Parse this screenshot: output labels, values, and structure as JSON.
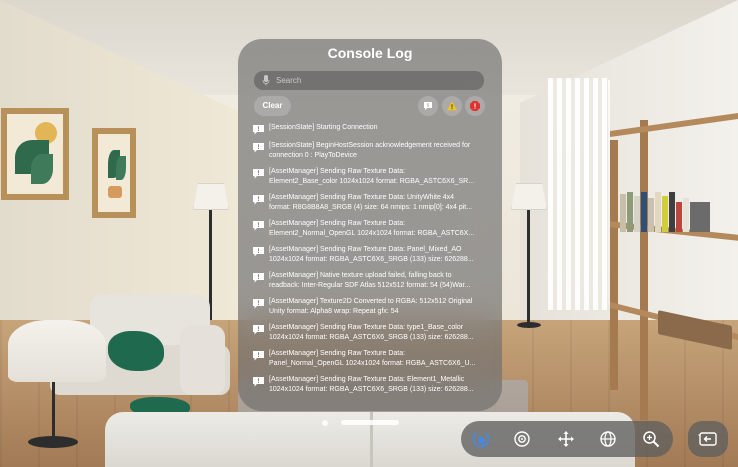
{
  "console": {
    "title": "Console Log",
    "search_placeholder": "Search",
    "clear_label": "Clear",
    "filters": [
      {
        "name": "info",
        "icon": "speech-bubble-icon",
        "color": "#ffffff"
      },
      {
        "name": "warning",
        "icon": "warning-triangle-icon",
        "color": "#f5c518"
      },
      {
        "name": "error",
        "icon": "error-octagon-icon",
        "color": "#e0342f"
      }
    ],
    "entries": [
      {
        "lines": [
          "[SessionState] Starting Connection"
        ]
      },
      {
        "lines": [
          "[SessionState] BeginHostSession acknowledgement received for",
          "connection 0 : PlayToDevice"
        ]
      },
      {
        "lines": [
          "[AssetManager] Sending Raw Texture Data:",
          "Element2_Base_color 1024x1024 format: RGBA_ASTC6X6_SR..."
        ]
      },
      {
        "lines": [
          "[AssetManager] Sending Raw Texture Data: UnityWhite 4x4",
          "format: R8G8B8A8_SRGB (4) size: 64 nmips: 1 nmip[0]: 4x4 pit..."
        ]
      },
      {
        "lines": [
          "[AssetManager] Sending Raw Texture Data:",
          "Element2_Normal_OpenGL 1024x1024 format: RGBA_ASTC6X..."
        ]
      },
      {
        "lines": [
          "[AssetManager] Sending Raw Texture Data: Panel_Mixed_AO",
          "1024x1024 format: RGBA_ASTC6X6_SRGB (133) size: 626288..."
        ]
      },
      {
        "lines": [
          "[AssetManager] Native texture upload failed, falling back to",
          "readback: Inter-Regular SDF Atlas 512x512 format: 54 (54)War..."
        ]
      },
      {
        "lines": [
          "[AssetManager] Texture2D Converted to RGBA: 512x512 Original",
          "Unity format: Alpha8 wrap: Repeat gfx: 54"
        ]
      },
      {
        "lines": [
          "[AssetManager] Sending Raw Texture Data: type1_Base_color",
          "1024x1024 format: RGBA_ASTC6X6_SRGB (133) size: 626288..."
        ]
      },
      {
        "lines": [
          "[AssetManager] Sending Raw Texture Data:",
          "Panel_Normal_OpenGL 1024x1024 format: RGBA_ASTC6X6_U..."
        ]
      },
      {
        "lines": [
          "[AssetManager] Sending Raw Texture Data: Element1_Metallic",
          "1024x1024 format: RGBA_ASTC6X6_SRGB (133) size: 626288..."
        ]
      }
    ]
  },
  "toolbar": {
    "tools": [
      {
        "name": "select-tool",
        "icon": "pointer-cursor-icon",
        "active": true
      },
      {
        "name": "orbit-tool",
        "icon": "orbit-target-icon"
      },
      {
        "name": "move-tool",
        "icon": "move-arrows-icon"
      },
      {
        "name": "globe-tool",
        "icon": "globe-icon"
      },
      {
        "name": "zoom-tool",
        "icon": "zoom-magnifier-icon"
      }
    ],
    "side_button_icon": "exit-view-icon",
    "accent": "#3d8cf5"
  }
}
